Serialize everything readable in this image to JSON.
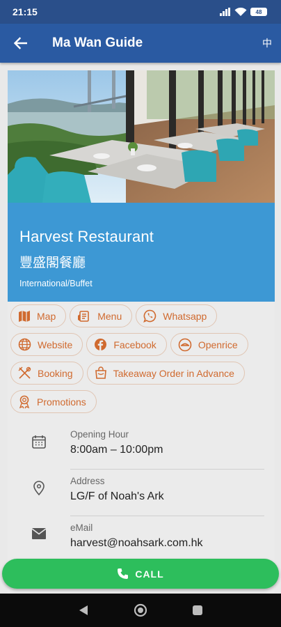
{
  "status_bar": {
    "time": "21:15",
    "battery": "48"
  },
  "app_bar": {
    "title": "Ma Wan Guide",
    "language_toggle": "中"
  },
  "restaurant": {
    "name": "Harvest Restaurant",
    "name_zh": "豐盛閣餐廳",
    "cuisine": "International/Buffet"
  },
  "actions": [
    {
      "label": "Map",
      "icon": "map-icon"
    },
    {
      "label": "Menu",
      "icon": "menu-icon"
    },
    {
      "label": "Whatsapp",
      "icon": "whatsapp-icon"
    },
    {
      "label": "Website",
      "icon": "globe-icon"
    },
    {
      "label": "Facebook",
      "icon": "facebook-icon"
    },
    {
      "label": "Openrice",
      "icon": "openrice-icon"
    },
    {
      "label": "Booking",
      "icon": "cutlery-icon"
    },
    {
      "label": "Takeaway Order in Advance",
      "icon": "bag-icon"
    },
    {
      "label": "Promotions",
      "icon": "award-icon"
    }
  ],
  "info": {
    "opening": {
      "label": "Opening Hour",
      "value": "8:00am – 10:00pm"
    },
    "address": {
      "label": "Address",
      "value": "LG/F of Noah's Ark"
    },
    "email": {
      "label": "eMail",
      "value": "harvest@noahsark.com.hk"
    }
  },
  "call_button": {
    "label": "CALL"
  },
  "colors": {
    "app_bar": "#2a5aa2",
    "name_panel": "#3d98d4",
    "chip_text": "#d06a2f",
    "call": "#2dbe5c"
  }
}
